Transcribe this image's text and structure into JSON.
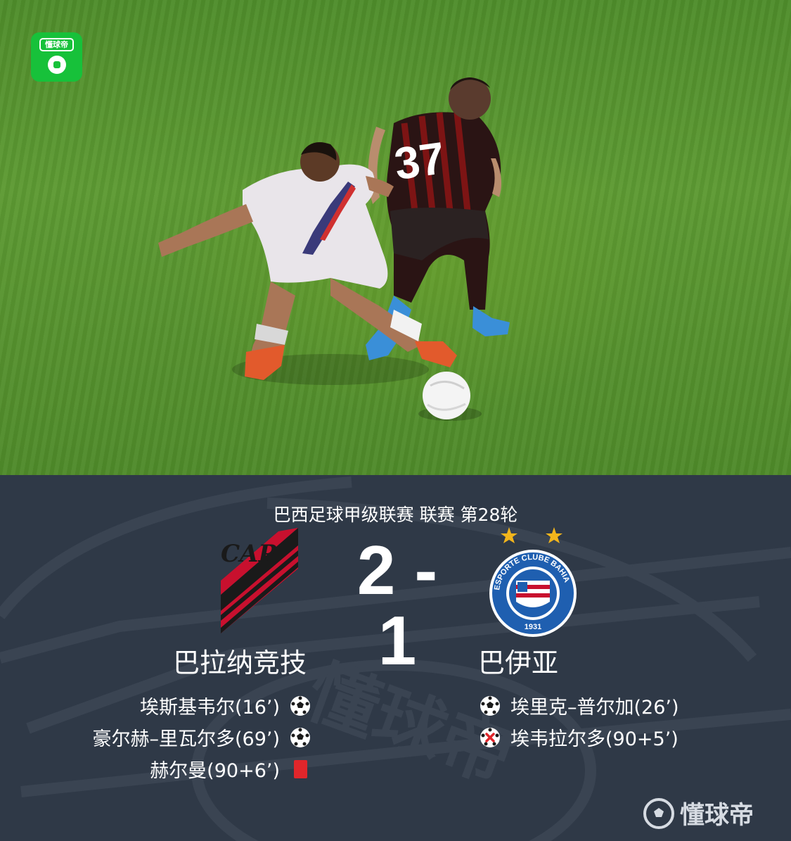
{
  "app_badge": {
    "text": "懂球帝",
    "icon": "soccer-ball-icon"
  },
  "photo": {
    "jersey_number": "37"
  },
  "match": {
    "competition": "巴西足球甲级联赛 联赛 第28轮",
    "score": "2 - 1",
    "home": {
      "name": "巴拉纳竞技",
      "crest_text": "CAP",
      "events": [
        {
          "text": "埃斯基韦尔(16’)",
          "icon": "goal-ball-icon"
        },
        {
          "text": "豪尔赫–里瓦尔多(69’)",
          "icon": "goal-ball-icon"
        },
        {
          "text": "赫尔曼(90+6’)",
          "icon": "red-card-icon"
        }
      ]
    },
    "away": {
      "name": "巴伊亚",
      "crest_text": "ESPORTE CLUBE BAHIA",
      "crest_year": "1931",
      "events": [
        {
          "text": "埃里克–普尔加(26’)",
          "icon": "goal-ball-icon"
        },
        {
          "text": "埃韦拉尔多(90+5’)",
          "icon": "missed-penalty-icon"
        }
      ]
    }
  },
  "watermark": "懂球帝",
  "colors": {
    "panel_bg": "#2f3947",
    "badge_green": "#17c13a",
    "home_red": "#c8102e",
    "away_blue": "#1f5fb0",
    "red_card": "#e0262b",
    "star_gold": "#f2b51c"
  }
}
